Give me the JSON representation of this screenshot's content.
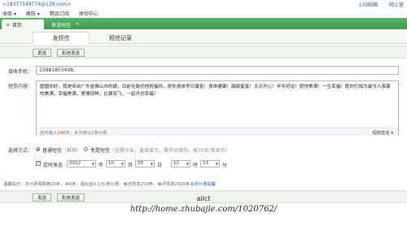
{
  "account": "<18377549774@139.com>",
  "top_links": [
    "139邮箱",
    "网上营"
  ],
  "menu": [
    "收取 ▾",
    "换肤 ▾",
    "精品订阅",
    "体验中心"
  ],
  "tabs": {
    "home": "首页",
    "send": "发送短信"
  },
  "subtabs": {
    "send": "发短信",
    "records": "短信记录"
  },
  "buttons": {
    "send": "发送",
    "mms": "彩信发送"
  },
  "recipient": {
    "label": "接收手机：",
    "value": "15981855498;"
  },
  "message": {
    "label": "短信内容：",
    "text": "圆圆你好，我是来自广东省佛山市的蜻，目前化致代他祝福你，祝你身体早日康复！身体健康！甜甜蜜蜜！天天开心！年年好运！愿快美满！一生幸福！愿你们成为最令人羡慕的美满，幸福美满，爱情保鲜，比翼双飞，一起共创幸福！",
    "count_prefix": "还可输入",
    "count_num": "246",
    "count_suffix": "字，本次将以2条计费",
    "signature": "短信签名 ▾"
  },
  "mode": {
    "label": "选择方式：",
    "option1": "普通短信",
    "option1_note": "（推荐）",
    "option2": "免提短信",
    "option2_note": "（无需点击，直接显示，需手动保存。按70字/条显示）"
  },
  "schedule": {
    "label": "定时发送",
    "year": "2012",
    "year_unit": "年",
    "month": "10",
    "month_unit": "月",
    "day": "25",
    "day_unit": "日",
    "hour": "12",
    "hour_unit": "时",
    "minute": "13",
    "minute_unit": "分"
  },
  "hint": {
    "text": "温馨提示：本计费周期赠20条，余6条，超出后0.1元/条计费，每天限发250条，每月限发2500条",
    "link": "关闭计费提醒"
  },
  "watermark": {
    "name": "ailct",
    "url": "http://home.zhubajie.com/1020762/"
  }
}
